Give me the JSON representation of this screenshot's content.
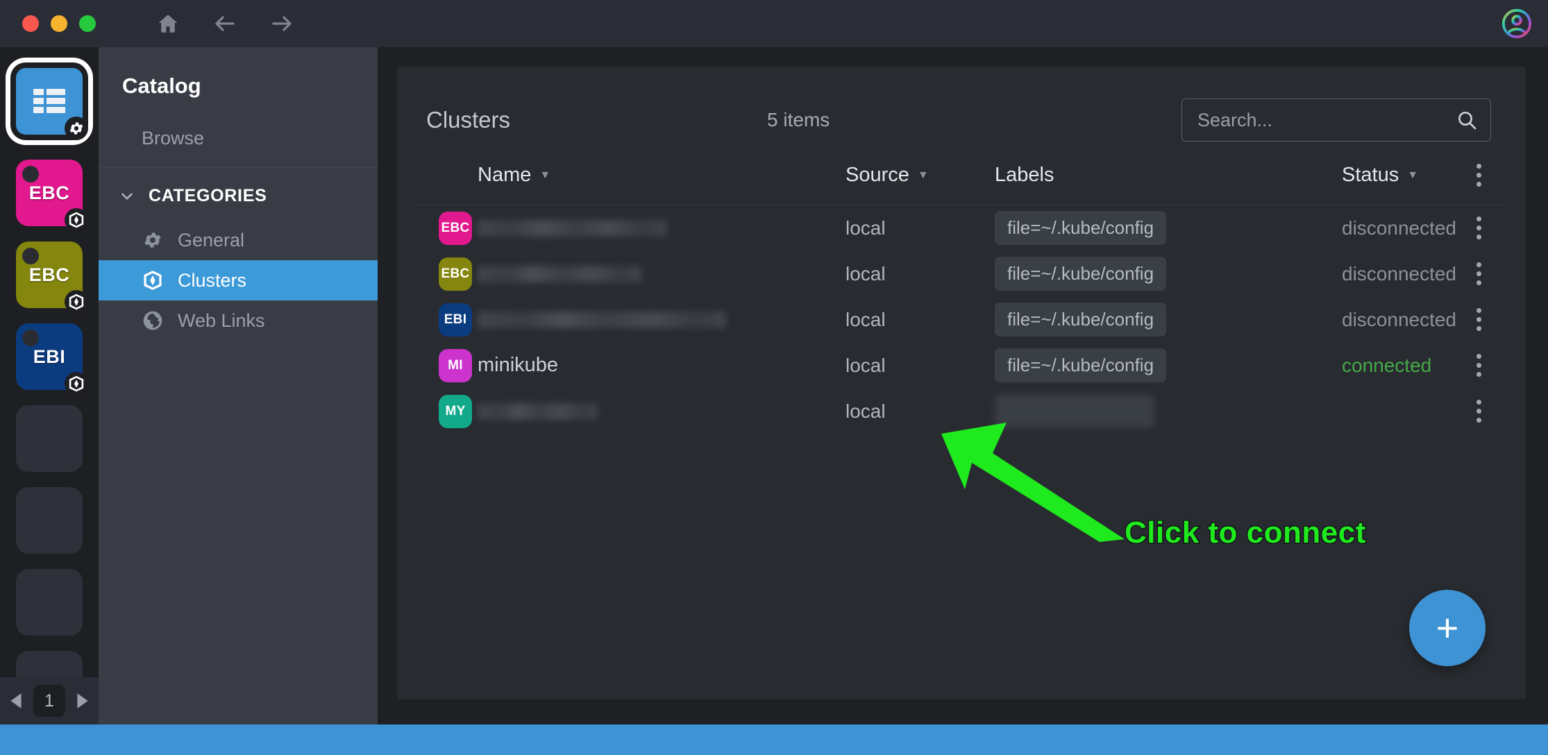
{
  "window": {
    "traffic_lights": [
      "close",
      "minimize",
      "zoom"
    ],
    "nav": [
      "home-icon",
      "back-arrow-icon",
      "forward-arrow-icon"
    ],
    "avatar": "user-avatar-icon"
  },
  "rail": {
    "items": [
      {
        "initials": "",
        "color": "#3d93d4",
        "icon": "catalog-grid-icon",
        "active": true,
        "badge": "gear-icon",
        "dot": false
      },
      {
        "initials": "EBC",
        "color": "#e2188e",
        "icon": "",
        "active": false,
        "badge": "kubernetes-icon",
        "dot": true
      },
      {
        "initials": "EBC",
        "color": "#85860d",
        "icon": "",
        "active": false,
        "badge": "kubernetes-icon",
        "dot": true
      },
      {
        "initials": "EBI",
        "color": "#0c3c80",
        "icon": "",
        "active": false,
        "badge": "kubernetes-icon",
        "dot": true
      },
      {
        "initials": "",
        "color": "#2e313a",
        "icon": "",
        "active": false,
        "badge": "",
        "dot": false
      },
      {
        "initials": "",
        "color": "#2e313a",
        "icon": "",
        "active": false,
        "badge": "",
        "dot": false
      },
      {
        "initials": "",
        "color": "#2e313a",
        "icon": "",
        "active": false,
        "badge": "",
        "dot": false
      },
      {
        "initials": "",
        "color": "#2e313a",
        "icon": "",
        "active": false,
        "badge": "",
        "dot": false
      }
    ],
    "pager": {
      "prev": "prev-page-icon",
      "page": "1",
      "next": "next-page-icon"
    }
  },
  "catalog": {
    "title": "Catalog",
    "browse_label": "Browse",
    "group_label": "CATEGORIES",
    "group_chevron": "chevron-down-icon",
    "items": [
      {
        "label": "General",
        "icon": "gear-icon",
        "selected": false
      },
      {
        "label": "Clusters",
        "icon": "kubernetes-icon",
        "selected": true
      },
      {
        "label": "Web Links",
        "icon": "globe-icon",
        "selected": false
      }
    ]
  },
  "content": {
    "title": "Clusters",
    "items_count": "5 items",
    "search": {
      "value": "",
      "placeholder": "Search...",
      "icon": "search-icon"
    },
    "columns": [
      {
        "label": "Name",
        "sortable": true
      },
      {
        "label": "Source",
        "sortable": true
      },
      {
        "label": "Labels",
        "sortable": false
      },
      {
        "label": "Status",
        "sortable": true
      }
    ],
    "header_menu_icon": "kebab-menu-icon",
    "rows": [
      {
        "initials": "EBC",
        "avatar_color": "#e2188e",
        "name": "",
        "name_redacted": true,
        "name_width": 272,
        "source": "local",
        "label": "file=~/.kube/config",
        "label_redacted": false,
        "status": "disconnected",
        "status_state": "disconnected",
        "menu_icon": "kebab-menu-icon"
      },
      {
        "initials": "EBC",
        "avatar_color": "#85860d",
        "name": "",
        "name_redacted": true,
        "name_width": 236,
        "source": "local",
        "label": "file=~/.kube/config",
        "label_redacted": false,
        "status": "disconnected",
        "status_state": "disconnected",
        "menu_icon": "kebab-menu-icon"
      },
      {
        "initials": "EBI",
        "avatar_color": "#0c3c80",
        "name": "",
        "name_redacted": true,
        "name_width": 358,
        "source": "local",
        "label": "file=~/.kube/config",
        "label_redacted": false,
        "status": "disconnected",
        "status_state": "disconnected",
        "menu_icon": "kebab-menu-icon"
      },
      {
        "initials": "MI",
        "avatar_color": "#cc33cc",
        "name": "minikube",
        "name_redacted": false,
        "name_width": 0,
        "source": "local",
        "label": "file=~/.kube/config",
        "label_redacted": false,
        "status": "connected",
        "status_state": "connected",
        "menu_icon": "kebab-menu-icon"
      },
      {
        "initials": "MY",
        "avatar_color": "#12a98a",
        "name": "",
        "name_redacted": true,
        "name_width": 172,
        "source": "local",
        "label": "redacted-label",
        "label_redacted": true,
        "status": "",
        "status_state": "none",
        "menu_icon": "kebab-menu-icon"
      }
    ],
    "fab": {
      "icon": "plus-icon",
      "label": "+"
    }
  },
  "annotation": {
    "text": "Click to connect",
    "arrow": "green-arrow-pointing-up-left",
    "color": "#1eea1e"
  },
  "colors": {
    "accent": "#3d93d4",
    "connected": "#46a948",
    "disconnected": "#8d929a",
    "annotation": "#1eea1e",
    "statusbar": "#3d93d4"
  }
}
